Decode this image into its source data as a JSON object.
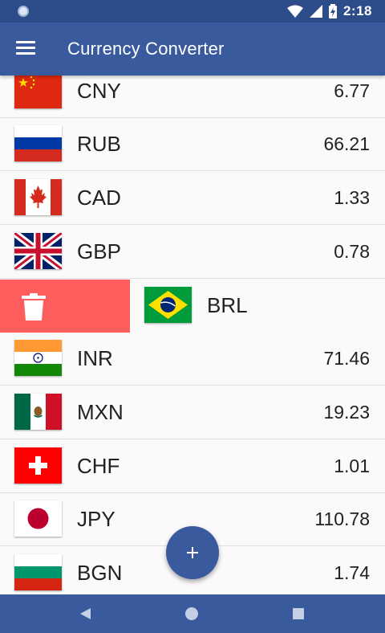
{
  "status_bar": {
    "time": "2:18"
  },
  "app_bar": {
    "title": "Currency Converter",
    "menu_icon": "hamburger-menu-icon"
  },
  "colors": {
    "primary": "#3a5a9e",
    "status_bar": "#2c4c8a",
    "delete": "#fe5d5d"
  },
  "currencies": [
    {
      "code": "CNY",
      "rate": "6.77",
      "flag": "china-flag-icon"
    },
    {
      "code": "RUB",
      "rate": "66.21",
      "flag": "russia-flag-icon"
    },
    {
      "code": "CAD",
      "rate": "1.33",
      "flag": "canada-flag-icon"
    },
    {
      "code": "GBP",
      "rate": "0.78",
      "flag": "uk-flag-icon"
    },
    {
      "code": "BRL",
      "rate": "",
      "flag": "brazil-flag-icon",
      "swiped": true,
      "action_icon": "trash-icon"
    },
    {
      "code": "INR",
      "rate": "71.46",
      "flag": "india-flag-icon"
    },
    {
      "code": "MXN",
      "rate": "19.23",
      "flag": "mexico-flag-icon"
    },
    {
      "code": "CHF",
      "rate": "1.01",
      "flag": "switzerland-flag-icon"
    },
    {
      "code": "JPY",
      "rate": "110.78",
      "flag": "japan-flag-icon"
    },
    {
      "code": "BGN",
      "rate": "1.74",
      "flag": "bulgaria-flag-icon"
    }
  ],
  "fab": {
    "icon": "plus-icon"
  },
  "nav_bar": {
    "back_icon": "back-triangle-icon",
    "home_icon": "home-circle-icon",
    "recents_icon": "recents-square-icon"
  }
}
